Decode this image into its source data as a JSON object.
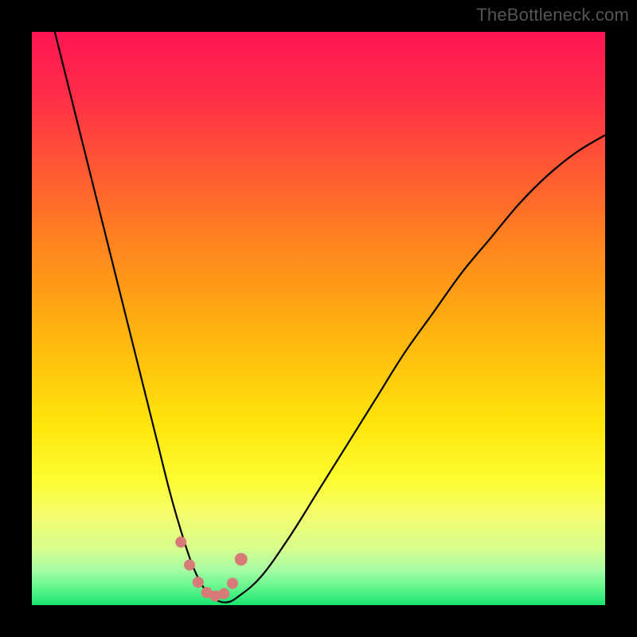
{
  "watermark": "TheBottleneck.com",
  "colors": {
    "curve_stroke": "#000000",
    "marker_fill": "#d87a78",
    "marker_stroke": "#b85a58",
    "frame_bg": "#000000"
  },
  "chart_data": {
    "type": "line",
    "title": "",
    "xlabel": "",
    "ylabel": "",
    "xlim": [
      0,
      100
    ],
    "ylim": [
      0,
      100
    ],
    "series": [
      {
        "name": "bottleneck-curve",
        "x": [
          4,
          6,
          8,
          10,
          12,
          14,
          16,
          18,
          20,
          22,
          24,
          26,
          28,
          30,
          32,
          34,
          36,
          40,
          45,
          50,
          55,
          60,
          65,
          70,
          75,
          80,
          85,
          90,
          95,
          100
        ],
        "y": [
          100,
          92,
          84,
          76,
          68,
          60,
          52,
          44,
          36,
          28,
          20,
          13,
          7,
          3,
          1,
          0.5,
          1.5,
          5,
          12,
          20,
          28,
          36,
          44,
          51,
          58,
          64,
          70,
          75,
          79,
          82
        ]
      }
    ],
    "markers": {
      "x": [
        26,
        27.5,
        29,
        30.5,
        32,
        33.5,
        35,
        36.5
      ],
      "y": [
        11,
        7,
        4,
        2.2,
        1.6,
        2,
        3.8,
        8
      ],
      "r": [
        7,
        7,
        7,
        7,
        7,
        7,
        7,
        8
      ]
    }
  }
}
